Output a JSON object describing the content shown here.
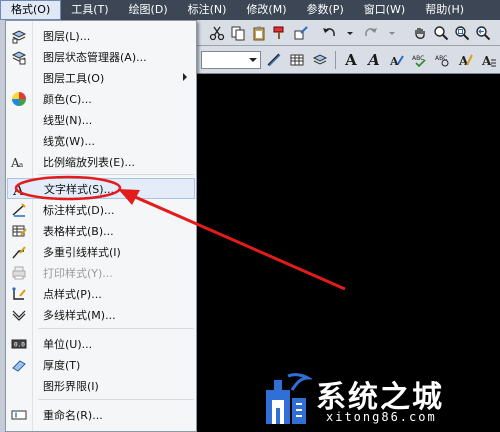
{
  "menubar": {
    "items": [
      {
        "label": "格式(O)",
        "active": true
      },
      {
        "label": "工具(T)"
      },
      {
        "label": "绘图(D)"
      },
      {
        "label": "标注(N)"
      },
      {
        "label": "修改(M)"
      },
      {
        "label": "参数(P)"
      },
      {
        "label": "窗口(W)"
      },
      {
        "label": "帮助(H)"
      }
    ]
  },
  "format_menu": {
    "items": [
      {
        "label": "图层(L)...",
        "icon": "layer-icon"
      },
      {
        "label": "图层状态管理器(A)...",
        "icon": "layer-state-icon"
      },
      {
        "label": "图层工具(O)",
        "icon": "",
        "submenu": true
      },
      {
        "label": "颜色(C)...",
        "icon": "color-wheel-icon"
      },
      {
        "label": "线型(N)...",
        "icon": ""
      },
      {
        "label": "线宽(W)...",
        "icon": ""
      },
      {
        "label": "比例缩放列表(E)...",
        "icon": "scale-list-icon"
      },
      {
        "label": "文字样式(S)...",
        "icon": "text-style-icon",
        "highlighted": true
      },
      {
        "label": "标注样式(D)...",
        "icon": "dimension-style-icon"
      },
      {
        "label": "表格样式(B)...",
        "icon": "table-style-icon"
      },
      {
        "label": "多重引线样式(I)",
        "icon": "multileader-style-icon"
      },
      {
        "label": "打印样式(Y)...",
        "icon": "plot-style-icon",
        "disabled": true
      },
      {
        "label": "点样式(P)...",
        "icon": "point-style-icon"
      },
      {
        "label": "多线样式(M)...",
        "icon": "multiline-style-icon"
      },
      {
        "label": "单位(U)...",
        "icon": "units-icon"
      },
      {
        "label": "厚度(T)",
        "icon": "thickness-icon"
      },
      {
        "label": "图形界限(I)",
        "icon": ""
      },
      {
        "label": "重命名(R)...",
        "icon": "rename-icon"
      }
    ]
  },
  "colors": {
    "menubar": "#3c4654",
    "menu_bg": "#f5f6f7",
    "highlight": "#e3ecf8",
    "annotation_red": "#e21b1b",
    "canvas": "#000000"
  },
  "watermark": {
    "title": "系统之城",
    "subtitle": "xitong86.com"
  }
}
